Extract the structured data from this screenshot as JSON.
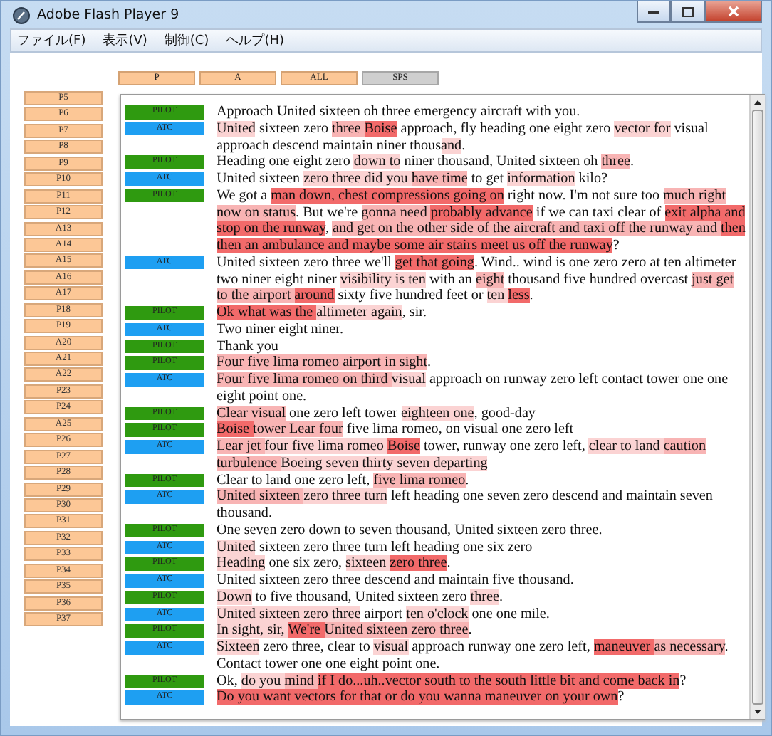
{
  "window": {
    "title": "Adobe Flash Player 9"
  },
  "menu": [
    "ファイル(F)",
    "表示(V)",
    "制御(C)",
    "ヘルプ(H)"
  ],
  "filters": [
    {
      "label": "P",
      "selected": false
    },
    {
      "label": "A",
      "selected": false
    },
    {
      "label": "ALL",
      "selected": false
    },
    {
      "label": "SPS",
      "selected": true
    }
  ],
  "segments_list": [
    "P5",
    "P6",
    "P7",
    "P8",
    "P9",
    "P10",
    "P11",
    "P12",
    "A13",
    "A14",
    "A15",
    "A16",
    "A17",
    "P18",
    "P19",
    "A20",
    "A21",
    "A22",
    "P23",
    "P24",
    "A25",
    "P26",
    "P27",
    "P28",
    "P29",
    "P30",
    "P31",
    "P32",
    "P33",
    "P34",
    "P35",
    "P36",
    "P37"
  ],
  "transcript": [
    {
      "tag": {
        "label": "PILOT",
        "color": "#2f9a10"
      },
      "lines": [
        [
          {
            "text": "Approach United sixteen oh three emergency aircraft with you."
          }
        ]
      ]
    },
    {
      "tag": {
        "label": "ATC",
        "color": "#1e9ff2"
      },
      "lines": [
        [
          {
            "text": "United",
            "color": "#fbd3d3"
          },
          {
            "text": " sixteen zero "
          },
          {
            "text": "three ",
            "color": "#f8b4b4"
          },
          {
            "text": "Boise",
            "color": "#f26a6a"
          },
          {
            "text": " approach, fly heading one eight zero "
          },
          {
            "text": "vector for",
            "color": "#fbd3d3"
          },
          {
            "text": " visual"
          }
        ],
        [
          {
            "text": "approach descend maintain niner thous"
          },
          {
            "text": "and",
            "color": "#fbd3d3"
          },
          {
            "text": "."
          }
        ]
      ]
    },
    {
      "tag": {
        "label": "PILOT",
        "color": "#2f9a10"
      },
      "lines": [
        [
          {
            "text": "Heading one eight zero "
          },
          {
            "text": "down to",
            "color": "#fbd3d3"
          },
          {
            "text": " niner thousand, United sixteen oh "
          },
          {
            "text": "three",
            "color": "#f8b4b4"
          },
          {
            "text": "."
          }
        ]
      ]
    },
    {
      "tag": {
        "label": "ATC",
        "color": "#1e9ff2"
      },
      "lines": [
        [
          {
            "text": "United sixteen "
          },
          {
            "text": "zero three did you ",
            "color": "#fbd3d3"
          },
          {
            "text": "have time",
            "color": "#f8b4b4"
          },
          {
            "text": " to get "
          },
          {
            "text": "information",
            "color": "#fbd3d3"
          },
          {
            "text": " kilo?"
          }
        ]
      ]
    },
    {
      "tag": {
        "label": "PILOT",
        "color": "#2f9a10"
      },
      "lines": [
        [
          {
            "text": "We got a "
          },
          {
            "text": "man down, chest compressions going on",
            "color": "#f26a6a"
          },
          {
            "text": " right now. I'm not sure too "
          },
          {
            "text": "much right",
            "color": "#f8b4b4"
          }
        ],
        [
          {
            "text": "now on ",
            "color": "#f8b4b4"
          },
          {
            "text": "status",
            "color": "#f8b4b4"
          },
          {
            "text": ". But we're "
          },
          {
            "text": "gonna need ",
            "color": "#f8b4b4"
          },
          {
            "text": "probably advance",
            "color": "#f26a6a"
          },
          {
            "text": " if we can taxi clear of "
          },
          {
            "text": "exit alpha and",
            "color": "#f26a6a"
          }
        ],
        [
          {
            "text": "stop on the runway",
            "color": "#f26a6a"
          },
          {
            "text": ", "
          },
          {
            "text": "and get on the other side of the aircraft and taxi off the runway and ",
            "color": "#f8b4b4"
          },
          {
            "text": "then",
            "color": "#f26a6a"
          }
        ],
        [
          {
            "text": "then an ambulance and maybe some air stairs meet us off the runway",
            "color": "#f26a6a"
          },
          {
            "text": "?"
          }
        ]
      ]
    },
    {
      "tag": {
        "label": "ATC",
        "color": "#1e9ff2"
      },
      "lines": [
        [
          {
            "text": "United sixteen zero three we'll "
          },
          {
            "text": "get that going",
            "color": "#f26a6a"
          },
          {
            "text": ". Wind.. wind is one zero zero at ten altimeter"
          }
        ],
        [
          {
            "text": "two niner eight niner "
          },
          {
            "text": "visibility is ten",
            "color": "#fbd3d3"
          },
          {
            "text": " with an "
          },
          {
            "text": "eight",
            "color": "#f8b4b4"
          },
          {
            "text": " thousand five hundred overcast "
          },
          {
            "text": "just get",
            "color": "#f8b4b4"
          }
        ],
        [
          {
            "text": "to the airport ",
            "color": "#f8b4b4"
          },
          {
            "text": "around",
            "color": "#f26a6a"
          },
          {
            "text": " sixty five hundred feet or "
          },
          {
            "text": "ten ",
            "color": "#fbd3d3"
          },
          {
            "text": "less",
            "color": "#f26a6a"
          },
          {
            "text": "."
          }
        ]
      ]
    },
    {
      "tag": {
        "label": "PILOT",
        "color": "#2f9a10"
      },
      "lines": [
        [
          {
            "text": "Ok what was the ",
            "color": "#f26a6a"
          },
          {
            "text": "altimeter again",
            "color": "#fbd3d3"
          },
          {
            "text": ", sir."
          }
        ]
      ]
    },
    {
      "tag": {
        "label": "ATC",
        "color": "#1e9ff2"
      },
      "lines": [
        [
          {
            "text": "Two niner eight niner."
          }
        ]
      ]
    },
    {
      "tag": {
        "label": "PILOT",
        "color": "#2f9a10"
      },
      "lines": [
        [
          {
            "text": "Thank you"
          }
        ]
      ]
    },
    {
      "tag": {
        "label": "PILOT",
        "color": "#2f9a10"
      },
      "lines": [
        [
          {
            "text": "Four five lima romeo airport in sight",
            "color": "#f8b4b4"
          },
          {
            "text": "."
          }
        ]
      ]
    },
    {
      "tag": {
        "label": "ATC",
        "color": "#1e9ff2"
      },
      "lines": [
        [
          {
            "text": "Four five lima romeo on third ",
            "color": "#f8b4b4"
          },
          {
            "text": "visual",
            "color": "#fbd3d3"
          },
          {
            "text": " approach on runway zero left contact tower one one"
          }
        ],
        [
          {
            "text": "eight point one."
          }
        ]
      ]
    },
    {
      "tag": {
        "label": "PILOT",
        "color": "#2f9a10"
      },
      "lines": [
        [
          {
            "text": "Clear visual",
            "color": "#f8b4b4"
          },
          {
            "text": " one zero left tower "
          },
          {
            "text": "eighteen one",
            "color": "#fbd3d3"
          },
          {
            "text": ", good-day"
          }
        ]
      ]
    },
    {
      "tag": {
        "label": "PILOT",
        "color": "#2f9a10"
      },
      "lines": [
        [
          {
            "text": "Boise ",
            "color": "#f26a6a"
          },
          {
            "text": "tower Lear four",
            "color": "#f8b4b4"
          },
          {
            "text": " five lima romeo, on visual one zero left"
          }
        ]
      ]
    },
    {
      "tag": {
        "label": "ATC",
        "color": "#1e9ff2"
      },
      "lines": [
        [
          {
            "text": "Lear jet ",
            "color": "#f8b4b4"
          },
          {
            "text": "four five lima romeo ",
            "color": "#fbd3d3"
          },
          {
            "text": "Boise",
            "color": "#f26a6a"
          },
          {
            "text": " tower, runway one zero left, "
          },
          {
            "text": "clear to land ",
            "color": "#fbd3d3"
          },
          {
            "text": "caution",
            "color": "#f8b4b4"
          }
        ],
        [
          {
            "text": "turbulence ",
            "color": "#f8b4b4"
          },
          {
            "text": "Boeing seven thirty seven departing",
            "color": "#fbd3d3"
          }
        ]
      ]
    },
    {
      "tag": {
        "label": "PILOT",
        "color": "#2f9a10"
      },
      "lines": [
        [
          {
            "text": "Clear to land one zero left, "
          },
          {
            "text": "five lima romeo",
            "color": "#f8b4b4"
          },
          {
            "text": "."
          }
        ]
      ]
    },
    {
      "tag": {
        "label": "ATC",
        "color": "#1e9ff2"
      },
      "lines": [
        [
          {
            "text": "United sixteen ",
            "color": "#f8b4b4"
          },
          {
            "text": "zero three turn",
            "color": "#fbd3d3"
          },
          {
            "text": " left heading one seven zero descend and maintain seven"
          }
        ],
        [
          {
            "text": "thousand."
          }
        ]
      ]
    },
    {
      "tag": {
        "label": "PILOT",
        "color": "#2f9a10"
      },
      "lines": [
        [
          {
            "text": "One seven zero down to seven thousand, United sixteen zero three."
          }
        ]
      ]
    },
    {
      "tag": {
        "label": "ATC",
        "color": "#1e9ff2"
      },
      "lines": [
        [
          {
            "text": "United",
            "color": "#fbd3d3"
          },
          {
            "text": " sixteen zero three turn left heading one six zero"
          }
        ]
      ]
    },
    {
      "tag": {
        "label": "PILOT",
        "color": "#2f9a10"
      },
      "lines": [
        [
          {
            "text": "Heading",
            "color": "#fbd3d3"
          },
          {
            "text": " one six zero, "
          },
          {
            "text": "sixteen ",
            "color": "#fbd3d3"
          },
          {
            "text": "zero three",
            "color": "#f26a6a"
          },
          {
            "text": "."
          }
        ]
      ]
    },
    {
      "tag": {
        "label": "ATC",
        "color": "#1e9ff2"
      },
      "lines": [
        [
          {
            "text": "United sixteen zero three descend and maintain five thousand."
          }
        ]
      ]
    },
    {
      "tag": {
        "label": "PILOT",
        "color": "#2f9a10"
      },
      "lines": [
        [
          {
            "text": "Down",
            "color": "#fbd3d3"
          },
          {
            "text": " to five thousand, United sixteen zero "
          },
          {
            "text": "three",
            "color": "#fbd3d3"
          },
          {
            "text": "."
          }
        ]
      ]
    },
    {
      "tag": {
        "label": "ATC",
        "color": "#1e9ff2"
      },
      "lines": [
        [
          {
            "text": "United sixteen zero three",
            "color": "#fbd3d3"
          },
          {
            "text": " airport "
          },
          {
            "text": "ten o'clock",
            "color": "#fbd3d3"
          },
          {
            "text": " one one mile."
          }
        ]
      ]
    },
    {
      "tag": {
        "label": "PILOT",
        "color": "#2f9a10"
      },
      "lines": [
        [
          {
            "text": "In sight, sir, ",
            "color": "#fbd3d3"
          },
          {
            "text": "We're ",
            "color": "#f26a6a"
          },
          {
            "text": "United sixteen zero three",
            "color": "#f8b4b4"
          },
          {
            "text": "."
          }
        ]
      ]
    },
    {
      "tag": {
        "label": "ATC",
        "color": "#1e9ff2"
      },
      "lines": [
        [
          {
            "text": "Sixteen",
            "color": "#fbd3d3"
          },
          {
            "text": " zero three, clear to "
          },
          {
            "text": "visual",
            "color": "#fbd3d3"
          },
          {
            "text": " approach runway one zero left, "
          },
          {
            "text": "maneuver ",
            "color": "#f26a6a"
          },
          {
            "text": "as necessary",
            "color": "#f8b4b4"
          },
          {
            "text": "."
          }
        ]
      ]
    },
    {
      "lines": [
        [
          {
            "text": "Contact tower one one eight point one."
          }
        ]
      ]
    },
    {
      "tag": {
        "label": "PILOT",
        "color": "#2f9a10"
      },
      "lines": [
        [
          {
            "text": "Ok, "
          },
          {
            "text": "do you ",
            "color": "#fbd3d3"
          },
          {
            "text": "mind ",
            "color": "#f8b4b4"
          },
          {
            "text": "if I do...uh..vector south to the south little bit and come back in",
            "color": "#f26a6a"
          },
          {
            "text": "?"
          }
        ]
      ]
    },
    {
      "tag": {
        "label": "ATC",
        "color": "#1e9ff2"
      },
      "lines": [
        [
          {
            "text": "Do you want vectors for that or do you wanna maneuver on your own",
            "color": "#f26a6a"
          },
          {
            "text": "?"
          }
        ]
      ]
    }
  ]
}
